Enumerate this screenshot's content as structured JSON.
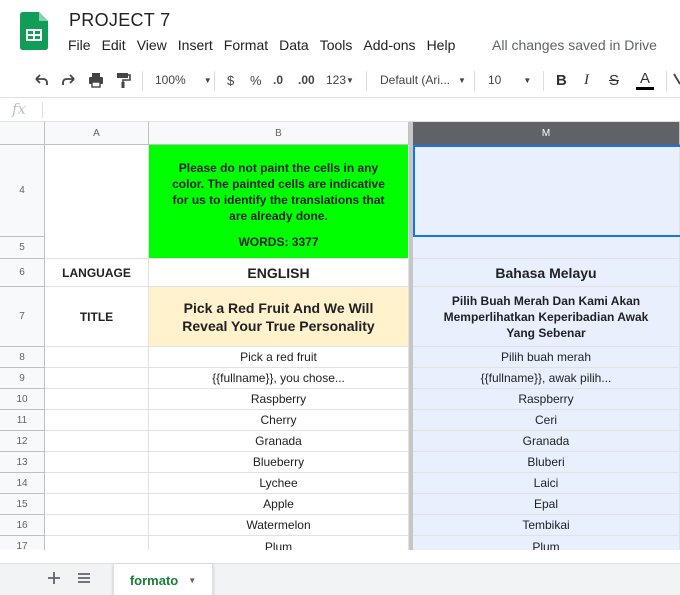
{
  "app": {
    "doc_title": "PROJECT 7",
    "menu": [
      "File",
      "Edit",
      "View",
      "Insert",
      "Format",
      "Data",
      "Tools",
      "Add-ons",
      "Help"
    ],
    "save_status": "All changes saved in Drive"
  },
  "toolbar": {
    "zoom": "100%",
    "currency": "$",
    "percent": "%",
    "dec_decrease": ".0",
    "dec_increase": ".00",
    "more_formats": "123",
    "font": "Default (Ari...",
    "font_size": "10",
    "bold": "B",
    "italic": "I",
    "strike": "S",
    "text_color": "A"
  },
  "formula_bar": {
    "fx": "fx"
  },
  "columns": {
    "A": "A",
    "B": "B",
    "M": "M"
  },
  "rows": {
    "r4": "4",
    "r5": "5",
    "r6": "6",
    "r7": "7",
    "r8": "8",
    "r9": "9",
    "r10": "10",
    "r11": "11",
    "r12": "12",
    "r13": "13",
    "r14": "14",
    "r15": "15",
    "r16": "16",
    "r17": "17"
  },
  "notice": {
    "line1": "Please do not paint the cells in any",
    "line2": "color. The painted cells are indicative",
    "line3": "for us to identify the translations that",
    "line4": "are already done.",
    "words": "WORDS: 3377"
  },
  "labels": {
    "language": "LANGUAGE",
    "title": "TITLE"
  },
  "header_row": {
    "english": "ENGLISH",
    "malay": "Bahasa Melayu"
  },
  "title_row": {
    "english_l1": "Pick a Red Fruit And We Will",
    "english_l2": "Reveal Your True Personality",
    "malay_l1": "Pilih Buah Merah Dan Kami Akan",
    "malay_l2": "Memperlihatkan Keperibadian Awak",
    "malay_l3": "Yang Sebenar"
  },
  "entries": [
    {
      "en": "Pick a red fruit",
      "ms": "Pilih buah merah"
    },
    {
      "en": "{{fullname}}, you chose...",
      "ms": "{{fullname}}, awak pilih..."
    },
    {
      "en": "Raspberry",
      "ms": "Raspberry"
    },
    {
      "en": "Cherry",
      "ms": "Ceri"
    },
    {
      "en": "Granada",
      "ms": "Granada"
    },
    {
      "en": "Blueberry",
      "ms": "Bluberi"
    },
    {
      "en": "Lychee",
      "ms": "Laici"
    },
    {
      "en": "Apple",
      "ms": "Epal"
    },
    {
      "en": "Watermelon",
      "ms": "Tembikai"
    },
    {
      "en": "Plum",
      "ms": "Plum"
    }
  ],
  "sheet_tabs": {
    "active": "formato"
  },
  "colors": {
    "notice_bg": "#00ff00",
    "title_bg": "#fff2cc",
    "selected_col_bg": "#e8f0fe",
    "accent": "#1a73e8",
    "sheets_green": "#188038"
  }
}
